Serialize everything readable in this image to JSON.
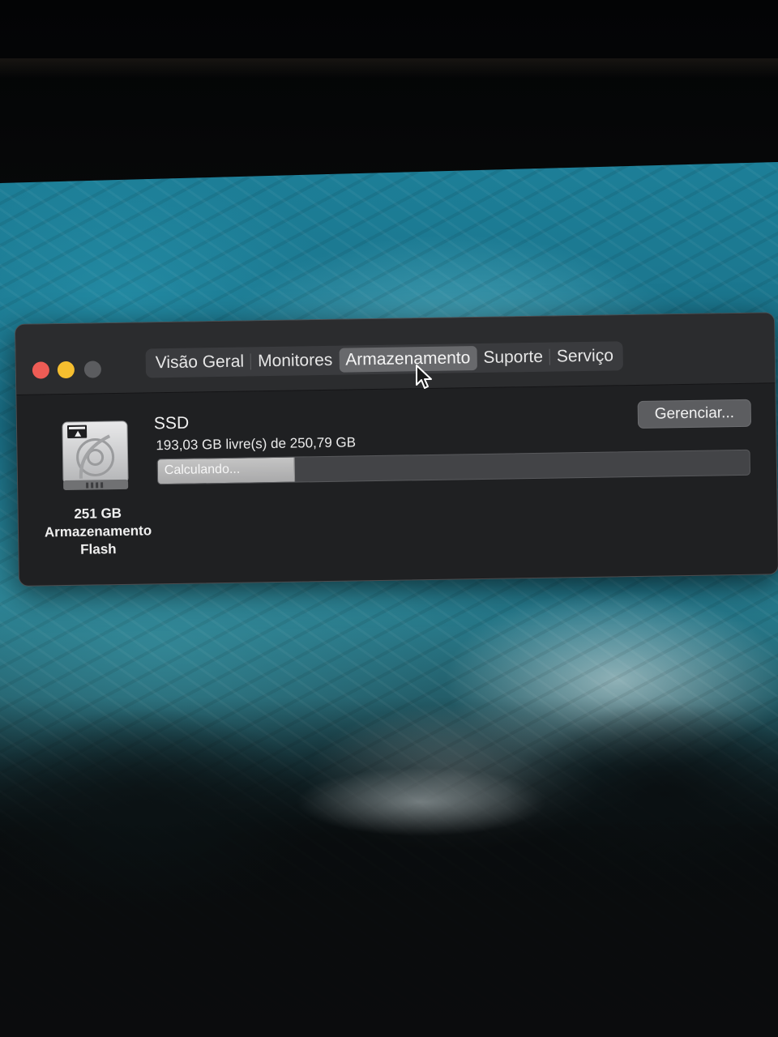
{
  "window": {
    "tabs": [
      {
        "label": "Visão Geral",
        "active": false
      },
      {
        "label": "Monitores",
        "active": false
      },
      {
        "label": "Armazenamento",
        "active": true
      },
      {
        "label": "Suporte",
        "active": false
      },
      {
        "label": "Serviço",
        "active": false
      }
    ]
  },
  "storage": {
    "drive_icon": "hard-drive-icon",
    "capacity": "251 GB",
    "type_line1": "Armazenamento",
    "type_line2": "Flash",
    "disk_name": "SSD",
    "free_text": "193,03 GB livre(s) de 250,79 GB",
    "manage_label": "Gerenciar...",
    "bar_status": "Calculando...",
    "calculated_fraction": 0.23
  },
  "colors": {
    "close": "#ee5c55",
    "minimize": "#f5be2f",
    "zoom": "#5b5c5f",
    "window_bg": "#1f2022"
  }
}
